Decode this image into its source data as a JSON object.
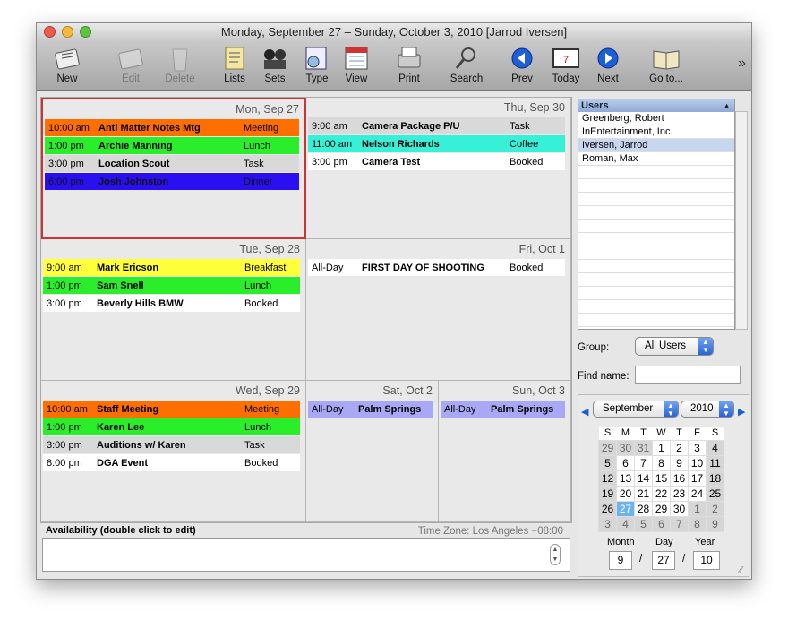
{
  "window": {
    "title": "Monday, September 27 – Sunday, October 3, 2010  [Jarrod Iversen]"
  },
  "toolbar": [
    {
      "label": "New",
      "icon": "new-icon",
      "enabled": true
    },
    {
      "label": "Edit",
      "icon": "edit-icon",
      "enabled": false
    },
    {
      "label": "Delete",
      "icon": "trash-icon",
      "enabled": false
    },
    {
      "label": "Lists",
      "icon": "lists-icon",
      "enabled": true
    },
    {
      "label": "Sets",
      "icon": "sets-icon",
      "enabled": true
    },
    {
      "label": "Type",
      "icon": "type-icon",
      "enabled": true
    },
    {
      "label": "View",
      "icon": "view-calendar-icon",
      "enabled": true
    },
    {
      "label": "Print",
      "icon": "printer-icon",
      "enabled": true
    },
    {
      "label": "Search",
      "icon": "magnifier-icon",
      "enabled": true
    },
    {
      "label": "Prev",
      "icon": "prev-arrow-icon",
      "enabled": true
    },
    {
      "label": "Today",
      "icon": "today-calendar-icon",
      "enabled": true
    },
    {
      "label": "Next",
      "icon": "next-arrow-icon",
      "enabled": true
    },
    {
      "label": "Go to...",
      "icon": "goto-book-icon",
      "enabled": true
    }
  ],
  "days": [
    {
      "header": "Mon, Sep 27",
      "events": [
        {
          "time": "10:00 am",
          "name": "Anti Matter Notes Mtg",
          "type": "Meeting",
          "color": "#ff6f00"
        },
        {
          "time": "1:00 pm",
          "name": "Archie Manning",
          "type": "Lunch",
          "color": "#2aee2a"
        },
        {
          "time": "3:00 pm",
          "name": "Location Scout",
          "type": "Task",
          "color": "#d9d9d9"
        },
        {
          "time": "6:00 pm",
          "name": "Josh Johnston",
          "type": "Dinner",
          "color": "#2a10f0"
        }
      ]
    },
    {
      "header": "Thu, Sep 30",
      "events": [
        {
          "time": "9:00 am",
          "name": "Camera Package P/U",
          "type": "Task",
          "color": "#d9d9d9"
        },
        {
          "time": "11:00 am",
          "name": "Nelson Richards",
          "type": "Coffee",
          "color": "#36f0d8"
        },
        {
          "time": "3:00 pm",
          "name": "Camera Test",
          "type": "Booked",
          "color": "#ffffff"
        }
      ]
    },
    {
      "header": "Tue, Sep 28",
      "events": [
        {
          "time": "9:00 am",
          "name": "Mark Ericson",
          "type": "Breakfast",
          "color": "#ffff3a"
        },
        {
          "time": "1:00 pm",
          "name": "Sam Snell",
          "type": "Lunch",
          "color": "#2aee2a"
        },
        {
          "time": "3:00 pm",
          "name": "Beverly Hills BMW",
          "type": "Booked",
          "color": "#ffffff"
        }
      ]
    },
    {
      "header": "Fri, Oct 1",
      "events": [
        {
          "time": "All-Day",
          "name": "FIRST DAY OF SHOOTING",
          "type": "Booked",
          "color": "#ffffff"
        }
      ]
    },
    {
      "header": "Wed, Sep 29",
      "events": [
        {
          "time": "10:00 am",
          "name": "Staff Meeting",
          "type": "Meeting",
          "color": "#ff6f00"
        },
        {
          "time": "1:00 pm",
          "name": "Karen Lee",
          "type": "Lunch",
          "color": "#2aee2a"
        },
        {
          "time": "3:00 pm",
          "name": "Auditions w/ Karen",
          "type": "Task",
          "color": "#d9d9d9"
        },
        {
          "time": "8:00 pm",
          "name": "DGA Event",
          "type": "Booked",
          "color": "#ffffff"
        }
      ]
    },
    {
      "header": "Sat, Oct 2",
      "events": [
        {
          "time": "All-Day",
          "name": "Palm Springs",
          "type": "",
          "color": "#a8a8f5"
        }
      ]
    },
    {
      "header": "Sun, Oct 3",
      "events": [
        {
          "time": "All-Day",
          "name": "Palm Springs",
          "type": "",
          "color": "#a8a8f5"
        }
      ]
    }
  ],
  "availability": {
    "label": "Availability (double click to edit)",
    "timezone": "Time Zone: Los Angeles −08:00",
    "value": ""
  },
  "users": {
    "header": "Users",
    "items": [
      "Greenberg, Robert",
      "InEntertainment, Inc.",
      "Iversen, Jarrod",
      "Roman, Max"
    ],
    "selected": 2
  },
  "group": {
    "label": "Group:",
    "value": "All Users"
  },
  "find": {
    "label": "Find name:",
    "value": ""
  },
  "minical": {
    "month": "September",
    "year": "2010",
    "weekdays": [
      "S",
      "M",
      "T",
      "W",
      "T",
      "F",
      "S"
    ],
    "weeks": [
      [
        "29",
        "30",
        "31",
        "1",
        "2",
        "3",
        "4"
      ],
      [
        "5",
        "6",
        "7",
        "8",
        "9",
        "10",
        "11"
      ],
      [
        "12",
        "13",
        "14",
        "15",
        "16",
        "17",
        "18"
      ],
      [
        "19",
        "20",
        "21",
        "22",
        "23",
        "24",
        "25"
      ],
      [
        "26",
        "27",
        "28",
        "29",
        "30",
        "1",
        "2"
      ],
      [
        "3",
        "4",
        "5",
        "6",
        "7",
        "8",
        "9"
      ]
    ],
    "today": "27",
    "labels": {
      "month": "Month",
      "day": "Day",
      "year": "Year"
    },
    "date": {
      "month": "9",
      "day": "27",
      "year": "10",
      "sep": "/"
    }
  },
  "colors": {
    "selection_border": "#cc3333",
    "accent": "#2a63d6"
  }
}
